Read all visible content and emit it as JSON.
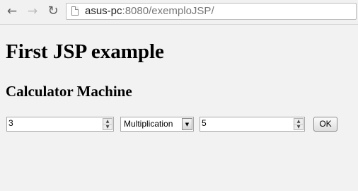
{
  "browser": {
    "url_host": "asus-pc",
    "url_rest": ":8080/exemploJSP/",
    "back_icon": "arrow-left-icon",
    "forward_icon": "arrow-right-icon",
    "reload_icon": "reload-icon"
  },
  "page": {
    "heading": "First JSP example",
    "subheading": "Calculator Machine"
  },
  "form": {
    "first_value": "3",
    "operation": "Multiplication",
    "second_value": "5",
    "submit_label": "OK"
  }
}
